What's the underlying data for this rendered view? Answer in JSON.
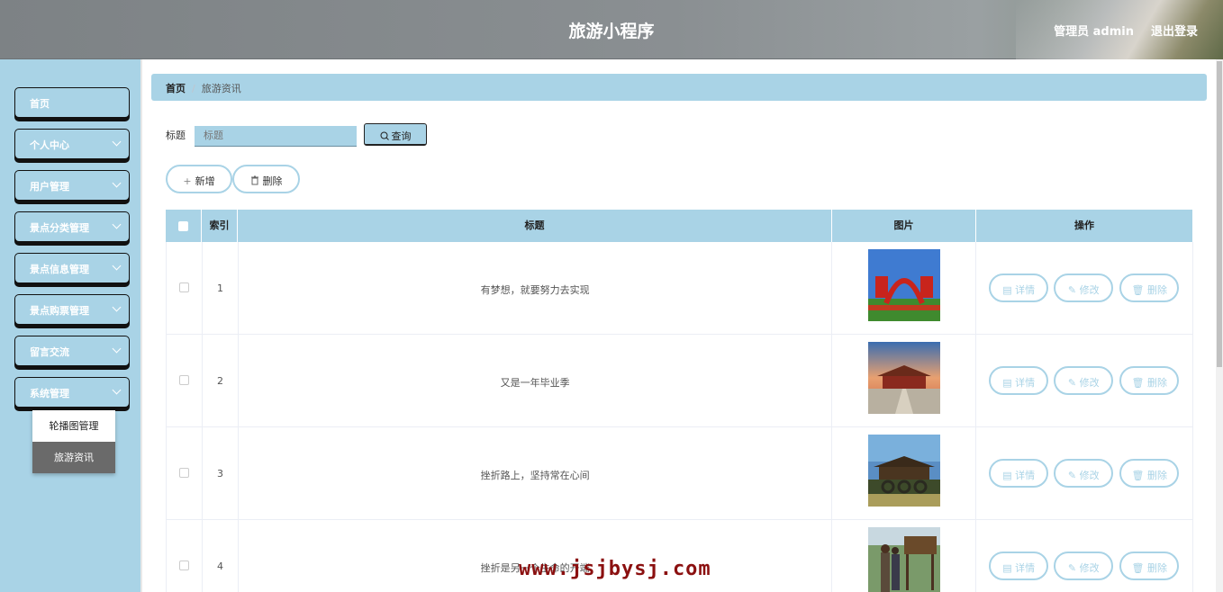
{
  "header": {
    "title": "旅游小程序",
    "user": "管理员 admin",
    "logout": "退出登录"
  },
  "sidebar": {
    "items": [
      {
        "label": "首页",
        "has_chevron": false
      },
      {
        "label": "个人中心",
        "has_chevron": true
      },
      {
        "label": "用户管理",
        "has_chevron": true
      },
      {
        "label": "景点分类管理",
        "has_chevron": true
      },
      {
        "label": "景点信息管理",
        "has_chevron": true
      },
      {
        "label": "景点购票管理",
        "has_chevron": true
      },
      {
        "label": "留言交流",
        "has_chevron": true
      },
      {
        "label": "系统管理",
        "has_chevron": true
      }
    ],
    "submenu": [
      {
        "label": "轮播图管理",
        "active": false
      },
      {
        "label": "旅游资讯",
        "active": true
      }
    ]
  },
  "breadcrumb": {
    "home": "首页",
    "separator": "/",
    "current": "旅游资讯"
  },
  "search": {
    "label": "标题",
    "placeholder": "标题",
    "button": "查询"
  },
  "actions": {
    "add": "新增",
    "delete": "删除"
  },
  "table": {
    "headers": [
      "索引",
      "标题",
      "图片",
      "操作"
    ],
    "rows": [
      {
        "index": "1",
        "title": "有梦想，就要努力去实现"
      },
      {
        "index": "2",
        "title": "又是一年毕业季"
      },
      {
        "index": "3",
        "title": "挫折路上，坚持常在心间"
      },
      {
        "index": "4",
        "title": "挫折是另一个生命的开端"
      }
    ],
    "ops": {
      "detail": "详情",
      "edit": "修改",
      "delete": "删除"
    }
  },
  "watermark": "www.jsjbysj.com"
}
